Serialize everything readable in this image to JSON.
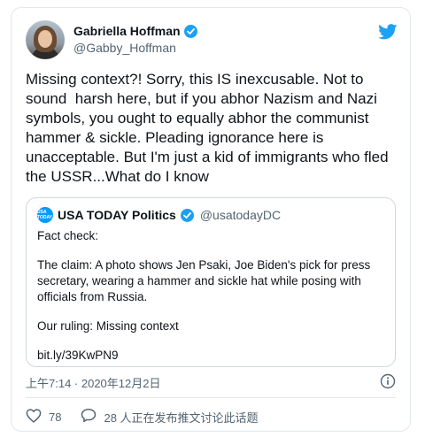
{
  "author": {
    "display_name": "Gabriella Hoffman",
    "handle": "@Gabby_Hoffman"
  },
  "tweet_text": "Missing context?! Sorry, this IS inexcusable. Not to sound  harsh here, but if you abhor Nazism and Nazi symbols, you ought to equally abhor the communist hammer & sickle. Pleading ignorance here is unacceptable. But I'm just a kid of immigrants who fled the USSR...What do I know",
  "quoted": {
    "avatar_text": "USA TODAY",
    "display_name": "USA TODAY Politics",
    "handle": "@usatodayDC",
    "line1": "Fact check:",
    "line2": "The claim: A photo shows Jen Psaki, Joe Biden's pick for press secretary, wearing a hammer and sickle hat while posing with officials from Russia.",
    "line3": "Our ruling: Missing context",
    "link": "bit.ly/39KwPN9"
  },
  "timestamp": "上午7:14 · 2020年12月2日",
  "likes": "78",
  "conversation": "28 人正在发布推文讨论此话题",
  "icons": {
    "brand": "twitter-bird-icon",
    "verified": "verified-badge-icon",
    "info": "info-icon",
    "like": "heart-icon",
    "reply": "speech-bubble-icon"
  },
  "colors": {
    "accent": "#1da1f2",
    "muted": "#536471"
  }
}
